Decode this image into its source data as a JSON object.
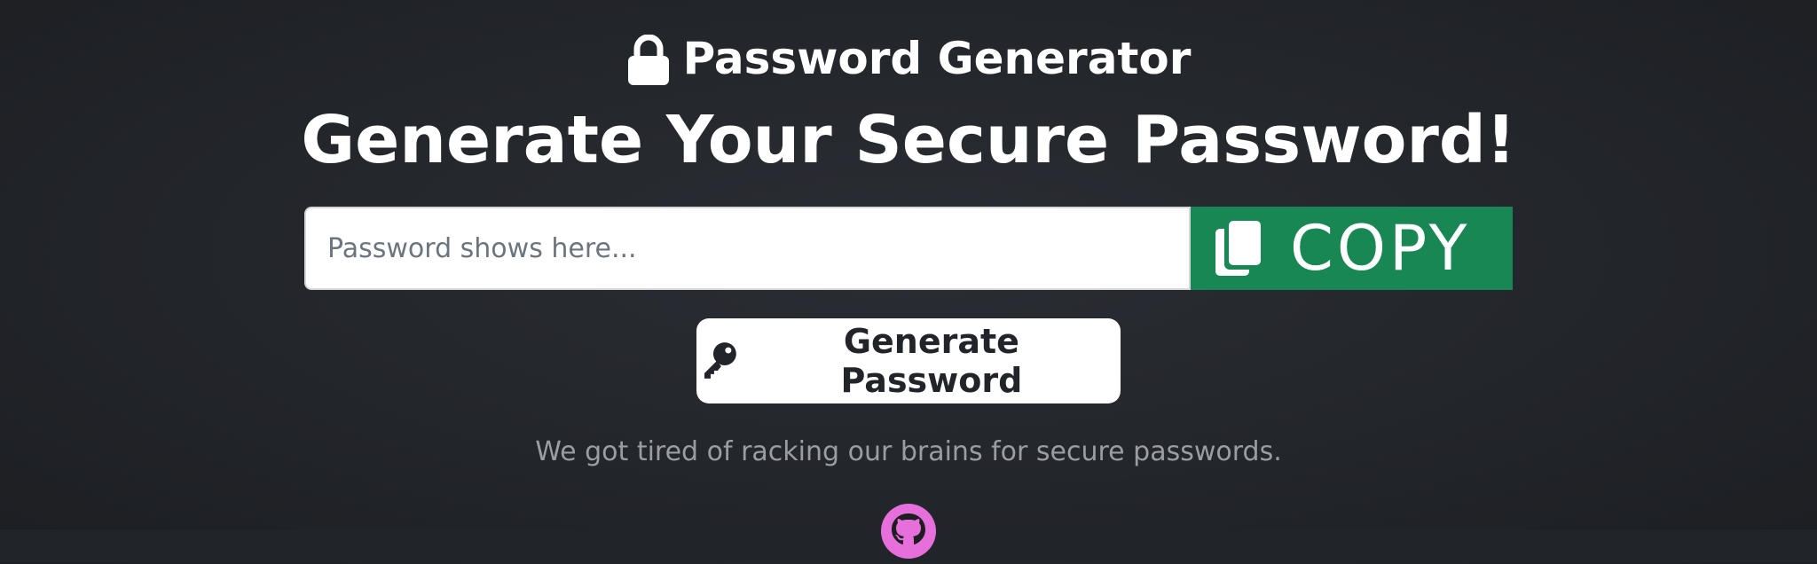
{
  "header": {
    "brand_title": "Password Generator",
    "brand_icon": "lock-icon"
  },
  "hero": {
    "title": "Generate Your Secure Password!"
  },
  "password_field": {
    "value": "",
    "placeholder": "Password shows here..."
  },
  "copy_button": {
    "label": "COPY",
    "icon": "copy-icon",
    "color": "#198754"
  },
  "generate_button": {
    "label": "Generate Password",
    "icon": "key-icon"
  },
  "tagline": "We got tired of racking our brains for secure passwords.",
  "footer": {
    "github_icon": "github-icon",
    "github_color": "#e76fdb"
  }
}
